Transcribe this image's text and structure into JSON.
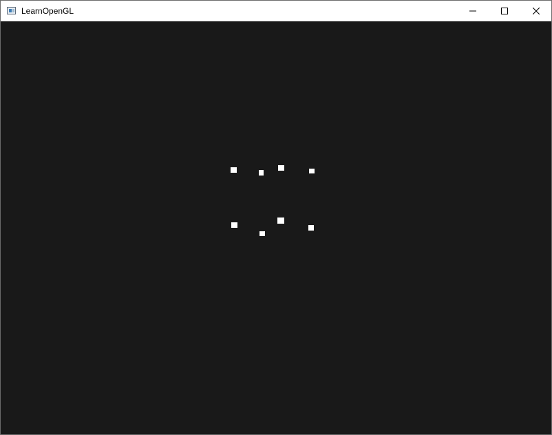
{
  "window": {
    "title": "LearnOpenGL",
    "icon": "application-window-icon",
    "controls": [
      "minimize-icon",
      "maximize-icon",
      "close-icon"
    ]
  },
  "viewport": {
    "background_color": "#191919",
    "object_color": "#ffffff",
    "object_count": 8
  }
}
